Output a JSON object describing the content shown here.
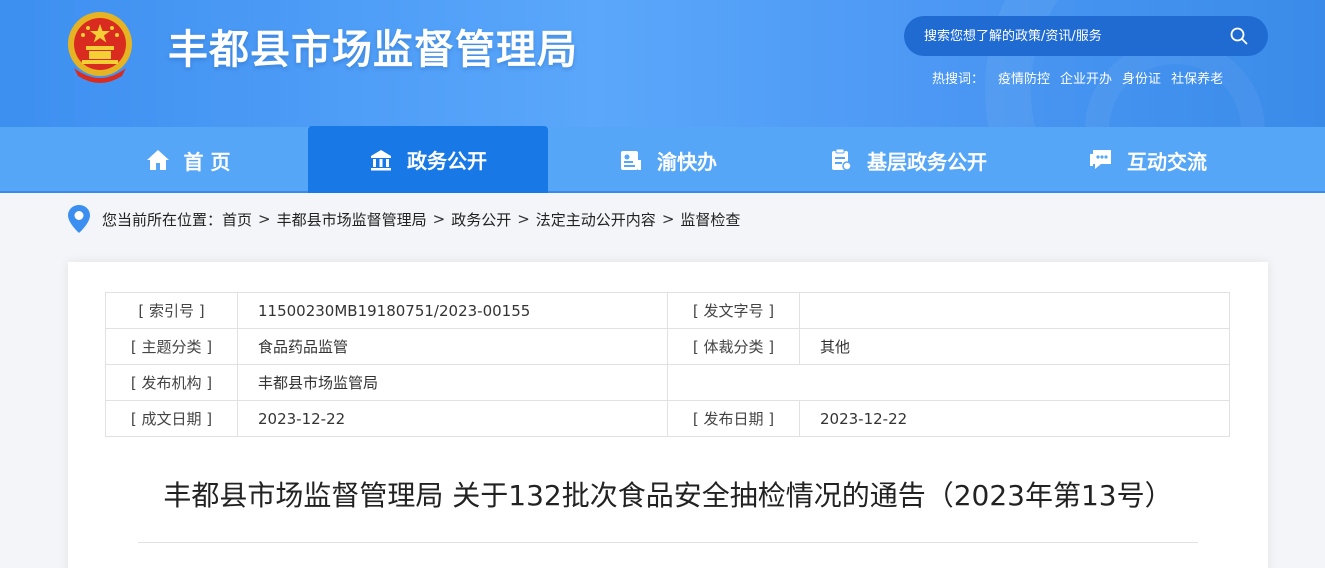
{
  "header": {
    "site_title": "丰都县市场监督管理局",
    "search_placeholder": "搜索您想了解的政策/资讯/服务",
    "hot_label": "热搜词：",
    "hot_words": [
      "疫情防控",
      "企业开办",
      "身份证",
      "社保养老"
    ]
  },
  "nav": {
    "items": [
      {
        "label": "首 页",
        "icon": "home-icon"
      },
      {
        "label": "政务公开",
        "icon": "building-icon"
      },
      {
        "label": "渝快办",
        "icon": "id-card-icon"
      },
      {
        "label": "基层政务公开",
        "icon": "clipboard-icon"
      },
      {
        "label": "互动交流",
        "icon": "chat-icon"
      }
    ],
    "active_index": 1
  },
  "breadcrumb": {
    "prefix": "您当前所在位置：",
    "items": [
      "首页",
      "丰都县市场监督管理局",
      "政务公开",
      "法定主动公开内容",
      "监督检查"
    ]
  },
  "meta": {
    "index_label": "[ 索引号 ]",
    "index_value": "11500230MB19180751/2023-00155",
    "doc_no_label": "[ 发文字号 ]",
    "doc_no_value": "",
    "topic_label": "[ 主题分类 ]",
    "topic_value": "食品药品监管",
    "genre_label": "[ 体裁分类 ]",
    "genre_value": "其他",
    "issuer_label": "[ 发布机构 ]",
    "issuer_value": "丰都县市场监管局",
    "created_label": "[ 成文日期 ]",
    "created_value": "2023-12-22",
    "published_label": "[ 发布日期 ]",
    "published_value": "2023-12-22"
  },
  "article": {
    "title": "丰都县市场监督管理局 关于132批次食品安全抽检情况的通告（2023年第13号）"
  },
  "colors": {
    "banner": "#4c98f4",
    "nav": "#56a6f8",
    "nav_active": "#1878e6",
    "search_bg": "#1f6bd1",
    "pin": "#3b8ff0"
  }
}
